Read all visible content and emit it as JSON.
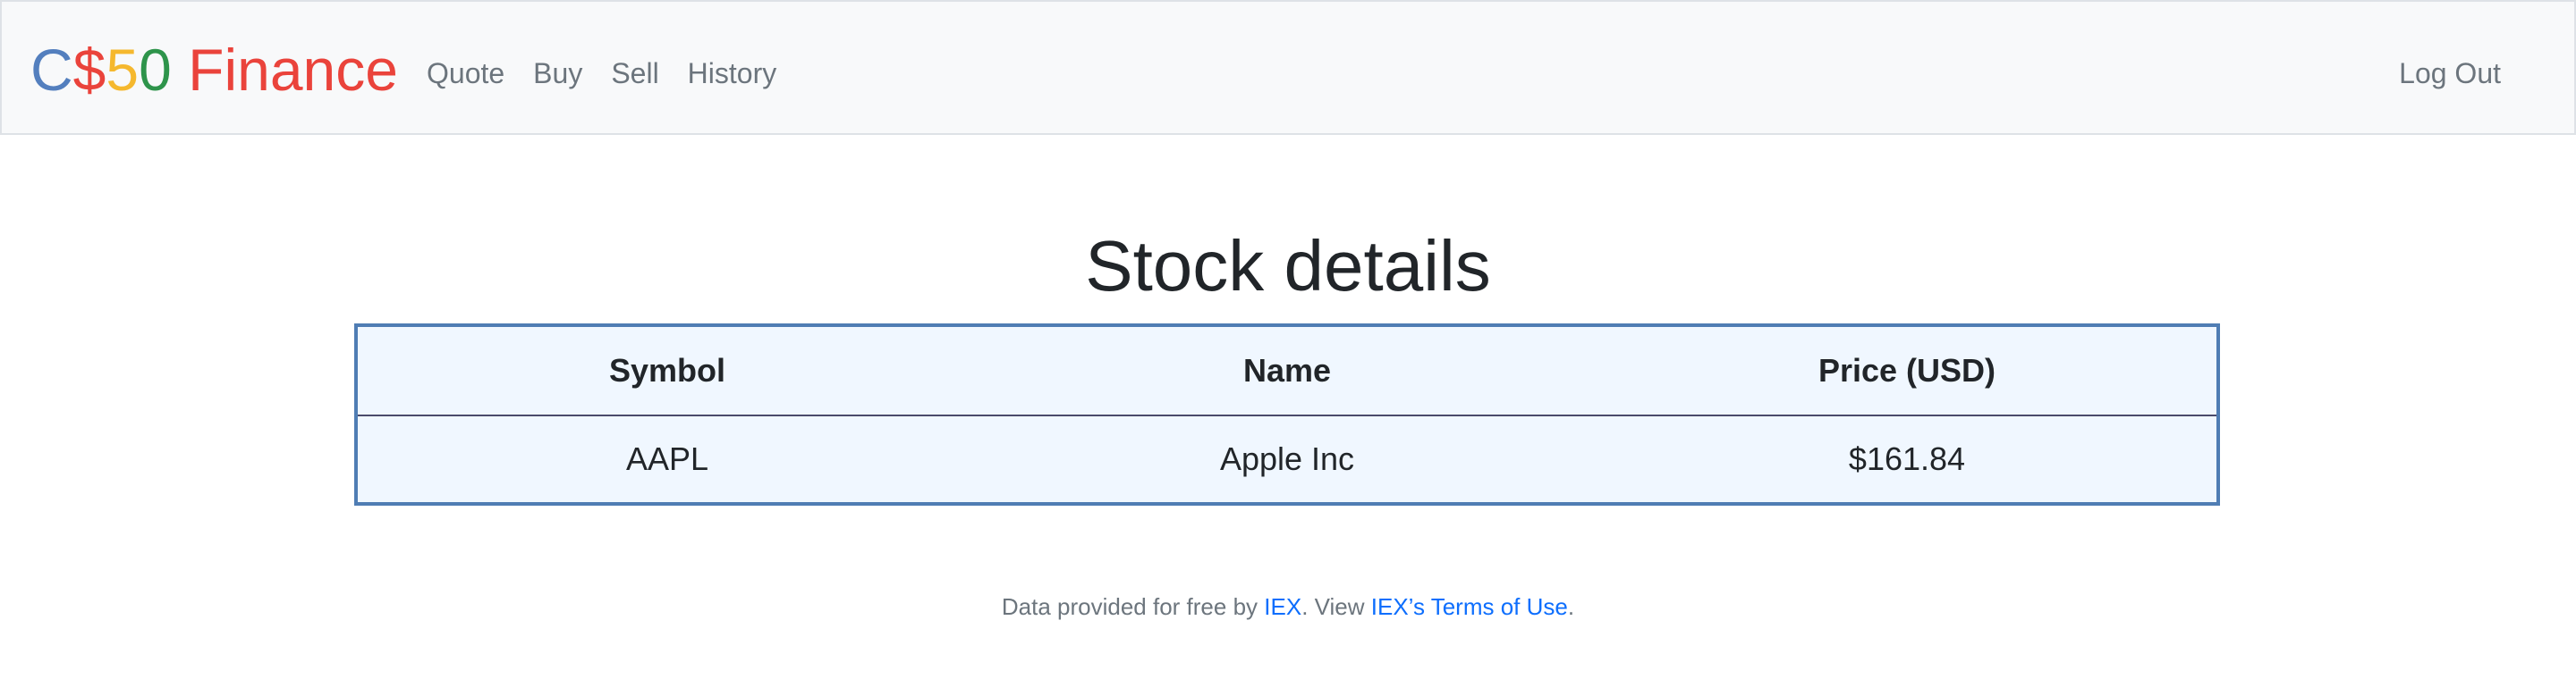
{
  "brand": {
    "c": "C",
    "dollar": "$",
    "five": "5",
    "zero": "0",
    "finance": " Finance"
  },
  "nav": {
    "items": [
      {
        "label": "Quote"
      },
      {
        "label": "Buy"
      },
      {
        "label": "Sell"
      },
      {
        "label": "History"
      }
    ],
    "logout_label": "Log Out"
  },
  "main": {
    "title": "Stock details",
    "table": {
      "headers": [
        "Symbol",
        "Name",
        "Price (USD)"
      ],
      "rows": [
        [
          "AAPL",
          "Apple Inc",
          "$161.84"
        ]
      ]
    }
  },
  "footer": {
    "prefix": "Data provided for free by ",
    "iex_link": "IEX",
    "middle": ". View ",
    "terms_link": "IEX’s Terms of Use",
    "suffix": "."
  },
  "colors": {
    "brand_blue": "#537fbe",
    "brand_red": "#ea433b",
    "brand_yellow": "#f5b82e",
    "brand_green": "#2e944b",
    "link": "#0d6efd",
    "table_border": "#4f7db4",
    "table_background": "#f0f7ff"
  }
}
